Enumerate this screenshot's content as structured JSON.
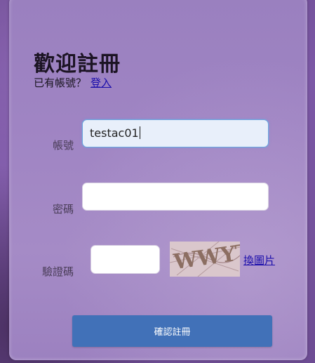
{
  "form": {
    "title": "歡迎註冊",
    "have_account_text": "已有帳號？",
    "login_link": "登入",
    "account_label": "帳號",
    "account_value": "testac01",
    "password_label": "密碼",
    "password_value": "",
    "captcha_label": "驗證碼",
    "captcha_value": "",
    "captcha_image_text": "WWYT",
    "refresh_captcha_link": "換圖片",
    "submit_label": "確認註冊"
  },
  "colors": {
    "submit_button": "#4171b8",
    "link": "#1a0dab",
    "card": "#9f84c3"
  }
}
